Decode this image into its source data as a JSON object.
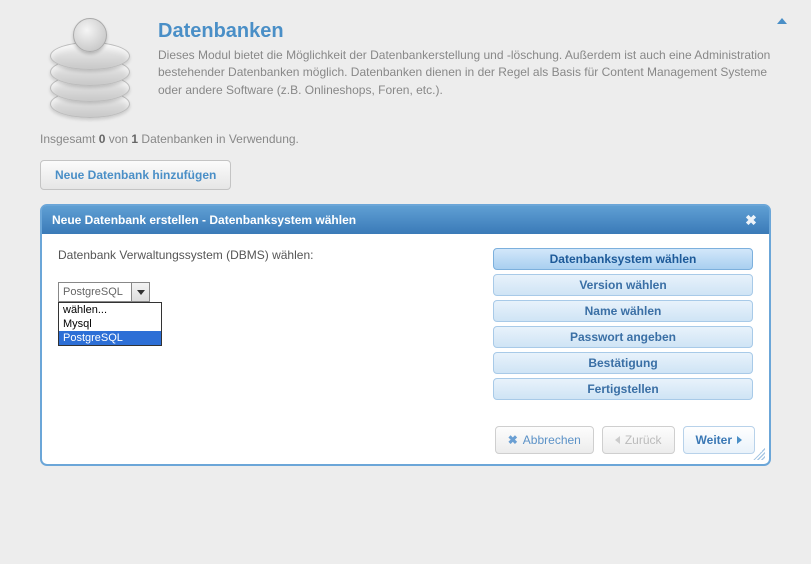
{
  "header": {
    "title": "Datenbanken",
    "description": "Dieses Modul bietet die Möglichkeit der Datenbankerstellung und -löschung. Außerdem ist auch eine Administration bestehender Datenbanken möglich. Datenbanken dienen in der Regel als Basis für Content Management Systeme oder andere Software (z.B. Onlineshops, Foren, etc.)."
  },
  "usage": {
    "prefix": "Insgesamt ",
    "used": "0",
    "mid": " von ",
    "total": "1",
    "suffix": " Datenbanken in Verwendung."
  },
  "add_button": "Neue Datenbank hinzufügen",
  "modal": {
    "title": "Neue Datenbank erstellen - Datenbanksystem wählen",
    "label": "Datenbank Verwaltungssystem (DBMS) wählen:",
    "select_value": "PostgreSQL",
    "options": [
      "wählen...",
      "Mysql",
      "PostgreSQL"
    ],
    "steps": [
      "Datenbanksystem wählen",
      "Version wählen",
      "Name wählen",
      "Passwort angeben",
      "Bestätigung",
      "Fertigstellen"
    ],
    "buttons": {
      "cancel": "Abbrechen",
      "back": "Zurück",
      "next": "Weiter"
    }
  }
}
